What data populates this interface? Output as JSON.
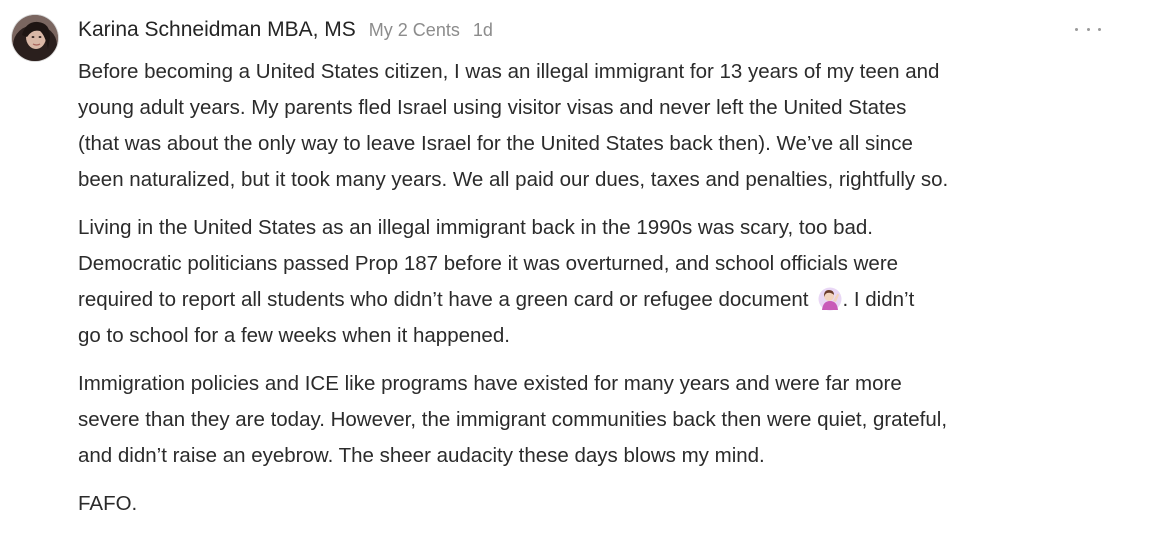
{
  "comment": {
    "author": "Karina Schneidman MBA, MS",
    "publication": "My 2 Cents",
    "time": "1d",
    "more_icon": "ellipsis-icon",
    "paragraphs": [
      {
        "lines": [
          "Before becoming a United States citizen, I was an illegal immigrant for 13 years of my teen and",
          "young adult years. My parents fled Israel using visitor visas and never left the United States",
          "(that was about the only way to leave Israel for the United States back then). We’ve all since",
          "been naturalized, but it took many years. We all paid our dues, taxes and penalties, rightfully so."
        ]
      },
      {
        "lines": [
          "Living in the United States as an illegal immigrant back in the 1990s was scary, too bad.",
          "Democratic politicians passed Prop 187 before it was overturned, and school officials were",
          "required to report all students who didn’t have a green card or refugee document",
          ". I didn’t",
          "go to school for a few weeks when it happened."
        ],
        "emoji": "woman-tipping-hand-emoji"
      },
      {
        "lines": [
          "Immigration policies and ICE like programs have existed for many years and were far more",
          "severe than they are today. However, the immigrant communities back then were quiet, grateful,",
          "and didn’t raise an eyebrow. The sheer audacity these days blows my mind."
        ]
      },
      {
        "lines": [
          "FAFO."
        ]
      }
    ]
  }
}
